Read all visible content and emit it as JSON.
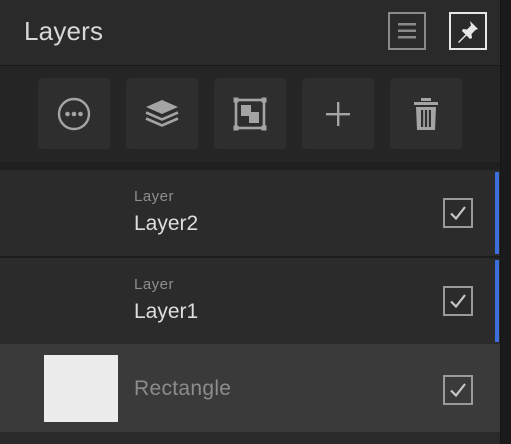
{
  "header": {
    "title": "Layers"
  },
  "toolbar": {
    "buttons": [
      {
        "icon": "more-options-icon"
      },
      {
        "icon": "layers-stack-icon"
      },
      {
        "icon": "artboard-icon"
      },
      {
        "icon": "add-icon"
      },
      {
        "icon": "trash-icon"
      }
    ]
  },
  "layers": [
    {
      "type": "Layer",
      "name": "Layer2",
      "visible": true,
      "selected": true
    },
    {
      "type": "Layer",
      "name": "Layer1",
      "visible": true,
      "selected": true
    },
    {
      "type": "",
      "name": "Rectangle",
      "visible": true,
      "selected": false
    }
  ],
  "colors": {
    "selection_accent": "#3c6fdc",
    "panel_bg": "#2a2a2a",
    "row_highlight": "#3a3a3a"
  }
}
